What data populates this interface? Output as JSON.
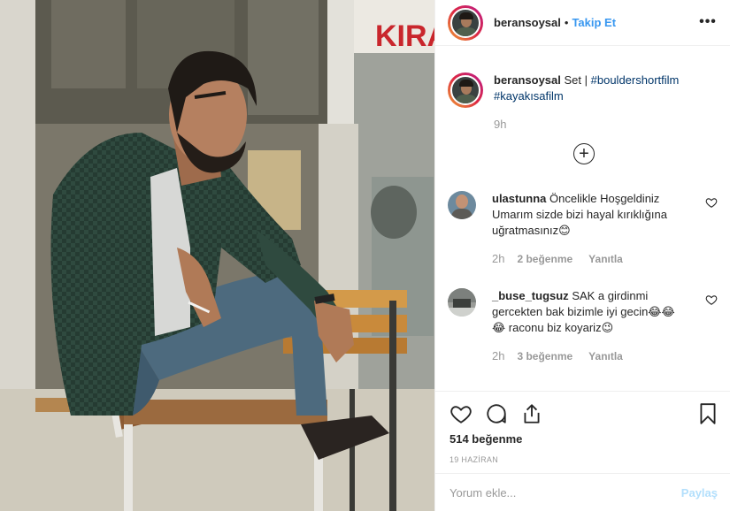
{
  "photo": {
    "sign_text": "KIRA",
    "colors": {
      "wall": "#c9c3b4",
      "shirt": "#2f4a3f",
      "jeans": "#4d6a7e",
      "bench": "#c98a3b"
    }
  },
  "header": {
    "username": "beransoysal",
    "separator": "•",
    "follow_label": "Takip Et",
    "more_icon": "ellipsis-icon",
    "more_label": "•••"
  },
  "caption": {
    "username": "beransoysal",
    "text": "Set |",
    "hashtags": [
      "#bouldershortfilm",
      "#kayakısafilm"
    ],
    "time": "9h"
  },
  "load_more_icon": "plus-circle-icon",
  "load_more_label": "+",
  "comments": [
    {
      "username": "ulastunna",
      "text": "Öncelikle Hoşgeldiniz Umarım sizde bizi hayal kırıklığına uğratmasınız😊",
      "time": "2h",
      "likes": "2 beğenme",
      "reply": "Yanıtla"
    },
    {
      "username": "_buse_tugsuz",
      "text": "SAK a girdinmi gercekten bak bizimle iyi gecin😂😂😂 raconu biz koyariz😉",
      "time": "2h",
      "likes": "3 beğenme",
      "reply": "Yanıtla"
    }
  ],
  "actions": {
    "like_icon": "heart-icon",
    "comment_icon": "comment-icon",
    "share_icon": "share-icon",
    "save_icon": "bookmark-icon",
    "likes_count": "514 beğenme",
    "date": "19 HAZİRAN"
  },
  "add_comment": {
    "placeholder": "Yorum ekle...",
    "post_label": "Paylaş"
  }
}
